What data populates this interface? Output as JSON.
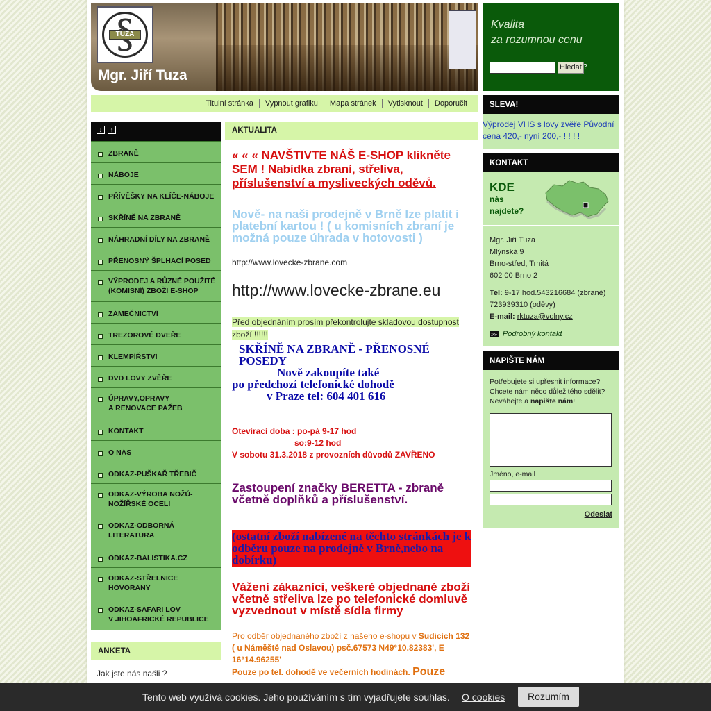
{
  "header": {
    "logo_tag": "TUZA",
    "logo_symbol": "§",
    "brand": "Mgr. Jiří Tuza",
    "slogan_line1": "Kvalita",
    "slogan_line2": "za rozumnou cenu",
    "search_button": "Hledat",
    "help": "?"
  },
  "topnav": [
    "Titulní stránka",
    "Vypnout grafiku",
    "Mapa stránek",
    "Vytisknout",
    "Doporučit"
  ],
  "sidebar": {
    "expand_icon": "↓",
    "collapse_icon": "↑",
    "items": [
      [
        "ZBRANĚ"
      ],
      [
        "NÁBOJE"
      ],
      [
        "PŘÍVĚŠKY NA KLÍČE-NÁBOJE"
      ],
      [
        "SKŘÍNĚ NA ZBRANĚ"
      ],
      [
        "NÁHRADNÍ DÍLY NA ZBRANĚ"
      ],
      [
        "PŘENOSNÝ ŠPLHACÍ POSED"
      ],
      [
        "VÝPRODEJ A RŮZNÉ POUŽITÉ",
        "(KOMISNÍ) ZBOŽÍ E-SHOP"
      ],
      [
        "ZÁMEČNICTVÍ"
      ],
      [
        "TREZOROVÉ DVEŘE"
      ],
      [
        "KLEMPÍŘSTVÍ"
      ],
      [
        "DVD LOVY ZVĚŘE"
      ],
      [
        "ÚPRAVY,OPRAVY",
        "A RENOVACE PAŽEB"
      ],
      [
        "KONTAKT"
      ],
      [
        "O NÁS"
      ],
      [
        "ODKAZ-PUŠKAŘ TŘEBIČ"
      ],
      [
        "ODKAZ-VÝROBA NOŽŮ-",
        "NOŽÍŘSKÉ OCELI"
      ],
      [
        "ODKAZ-ODBORNÁ",
        "LITERATURA"
      ],
      [
        "ODKAZ-BALISTIKA.CZ"
      ],
      [
        "ODKAZ-STŘELNICE",
        "HOVORANY"
      ],
      [
        "ODKAZ-SAFARI LOV",
        "V JIHOAFRICKÉ REPUBLICE"
      ]
    ],
    "anketa_title": "ANKETA",
    "anketa_question": "Jak jste nás našli ?"
  },
  "main": {
    "title": "AKTUALITA",
    "eshop": "« « « NAVŠTIVTE NÁŠ  E-SHOP        klikněte SEM !    Nabídka   zbraní,   střeliva,   příslušenství a mysliveckých oděvů.",
    "card": "Nově- na naši prodejně v Brně lze platit i platební kartou ! ( u komisních zbraní je možná pouze úhrada v hotovosti )",
    "url_small": "http://www.lovecke-zbrane.com",
    "url_big": "http://www.lovecke-zbrane.eu",
    "check": " Před objednáním prosím překontrolujte skladovou dostupnost zboží !!!!!!",
    "skrine_1": "SKŘÍNĚ NA ZBRANĚ - PŘENOSNÉ POSEDY",
    "skrine_2": "Nově zakoupíte také",
    "skrine_3": "po předchozí telefonické dohodě",
    "skrine_4": "v Praze tel: 604 401 616",
    "hours_1": "Otevírací doba : po-pá 9-17 hod",
    "hours_2": "so:9-12 hod",
    "hours_3": "V sobotu 31.3.2018 z provozních důvodů ZAVŘENO",
    "beretta": "Zastoupení značky BERETTA - zbraně včetně doplňků a příslušenství.",
    "redbox": "(ostatní zboží nabízené na těchto stránkách je k odběru pouze na prodejně v Brně,nebo na dobírku)",
    "vazeni": "Vážení zákazníci, veškeré objednané zboží včetně střeliva lze po telefonické domluvě vyzvednout v místě sídla firmy",
    "pickup_1": "Pro odběr objednaného zboží z našeho e-shopu v ",
    "pickup_2": "Sudicích 132 ( u Náměště nad Oslavou) psč.67573 N49°10.82383', E 16°14.96255'",
    "pickup_3": "Pouze po tel. dohodě ve večerních hodinách.",
    "pickup_4": "Pouze"
  },
  "right": {
    "sleva_title": "SLEVA!",
    "sleva_text": "Výprodej VHS s lovy zvěře  Původní cena 420,-       nyní 200,- ! ! ! !",
    "kontakt_title": "KONTAKT",
    "kde": "KDE",
    "kde_sub1": "nás",
    "kde_sub2": "najdete?",
    "addr_1": "Mgr. Jiří Tuza",
    "addr_2": "Mlýnská 9",
    "addr_3": "Brno-střed, Trnitá",
    "addr_4": "602 00 Brno 2",
    "tel_label": "Tel:",
    "tel_1": " 9-17 hod.543216684 (zbraně)",
    "tel_2": "723939310 (oděvy)",
    "email_label": "E-mail:",
    "email": "rktuza@volny.cz",
    "detail_link": "Podrobný kontakt",
    "napiste_title": "NAPIŠTE NÁM",
    "napiste_1": "Potřebujete si upřesnit informace?",
    "napiste_2": "Chcete nám něco důležitého sdělit?",
    "napiste_3a": "Neváhejte a ",
    "napiste_3b": "napište nám",
    "napiste_3c": "!",
    "name_label": "Jméno, e-mail",
    "send": "Odeslat"
  },
  "cookie": {
    "text": "Tento web využívá cookies. Jeho používáním s tím vyjadřujete souhlas.",
    "link": "O cookies",
    "button": "Rozumím"
  }
}
